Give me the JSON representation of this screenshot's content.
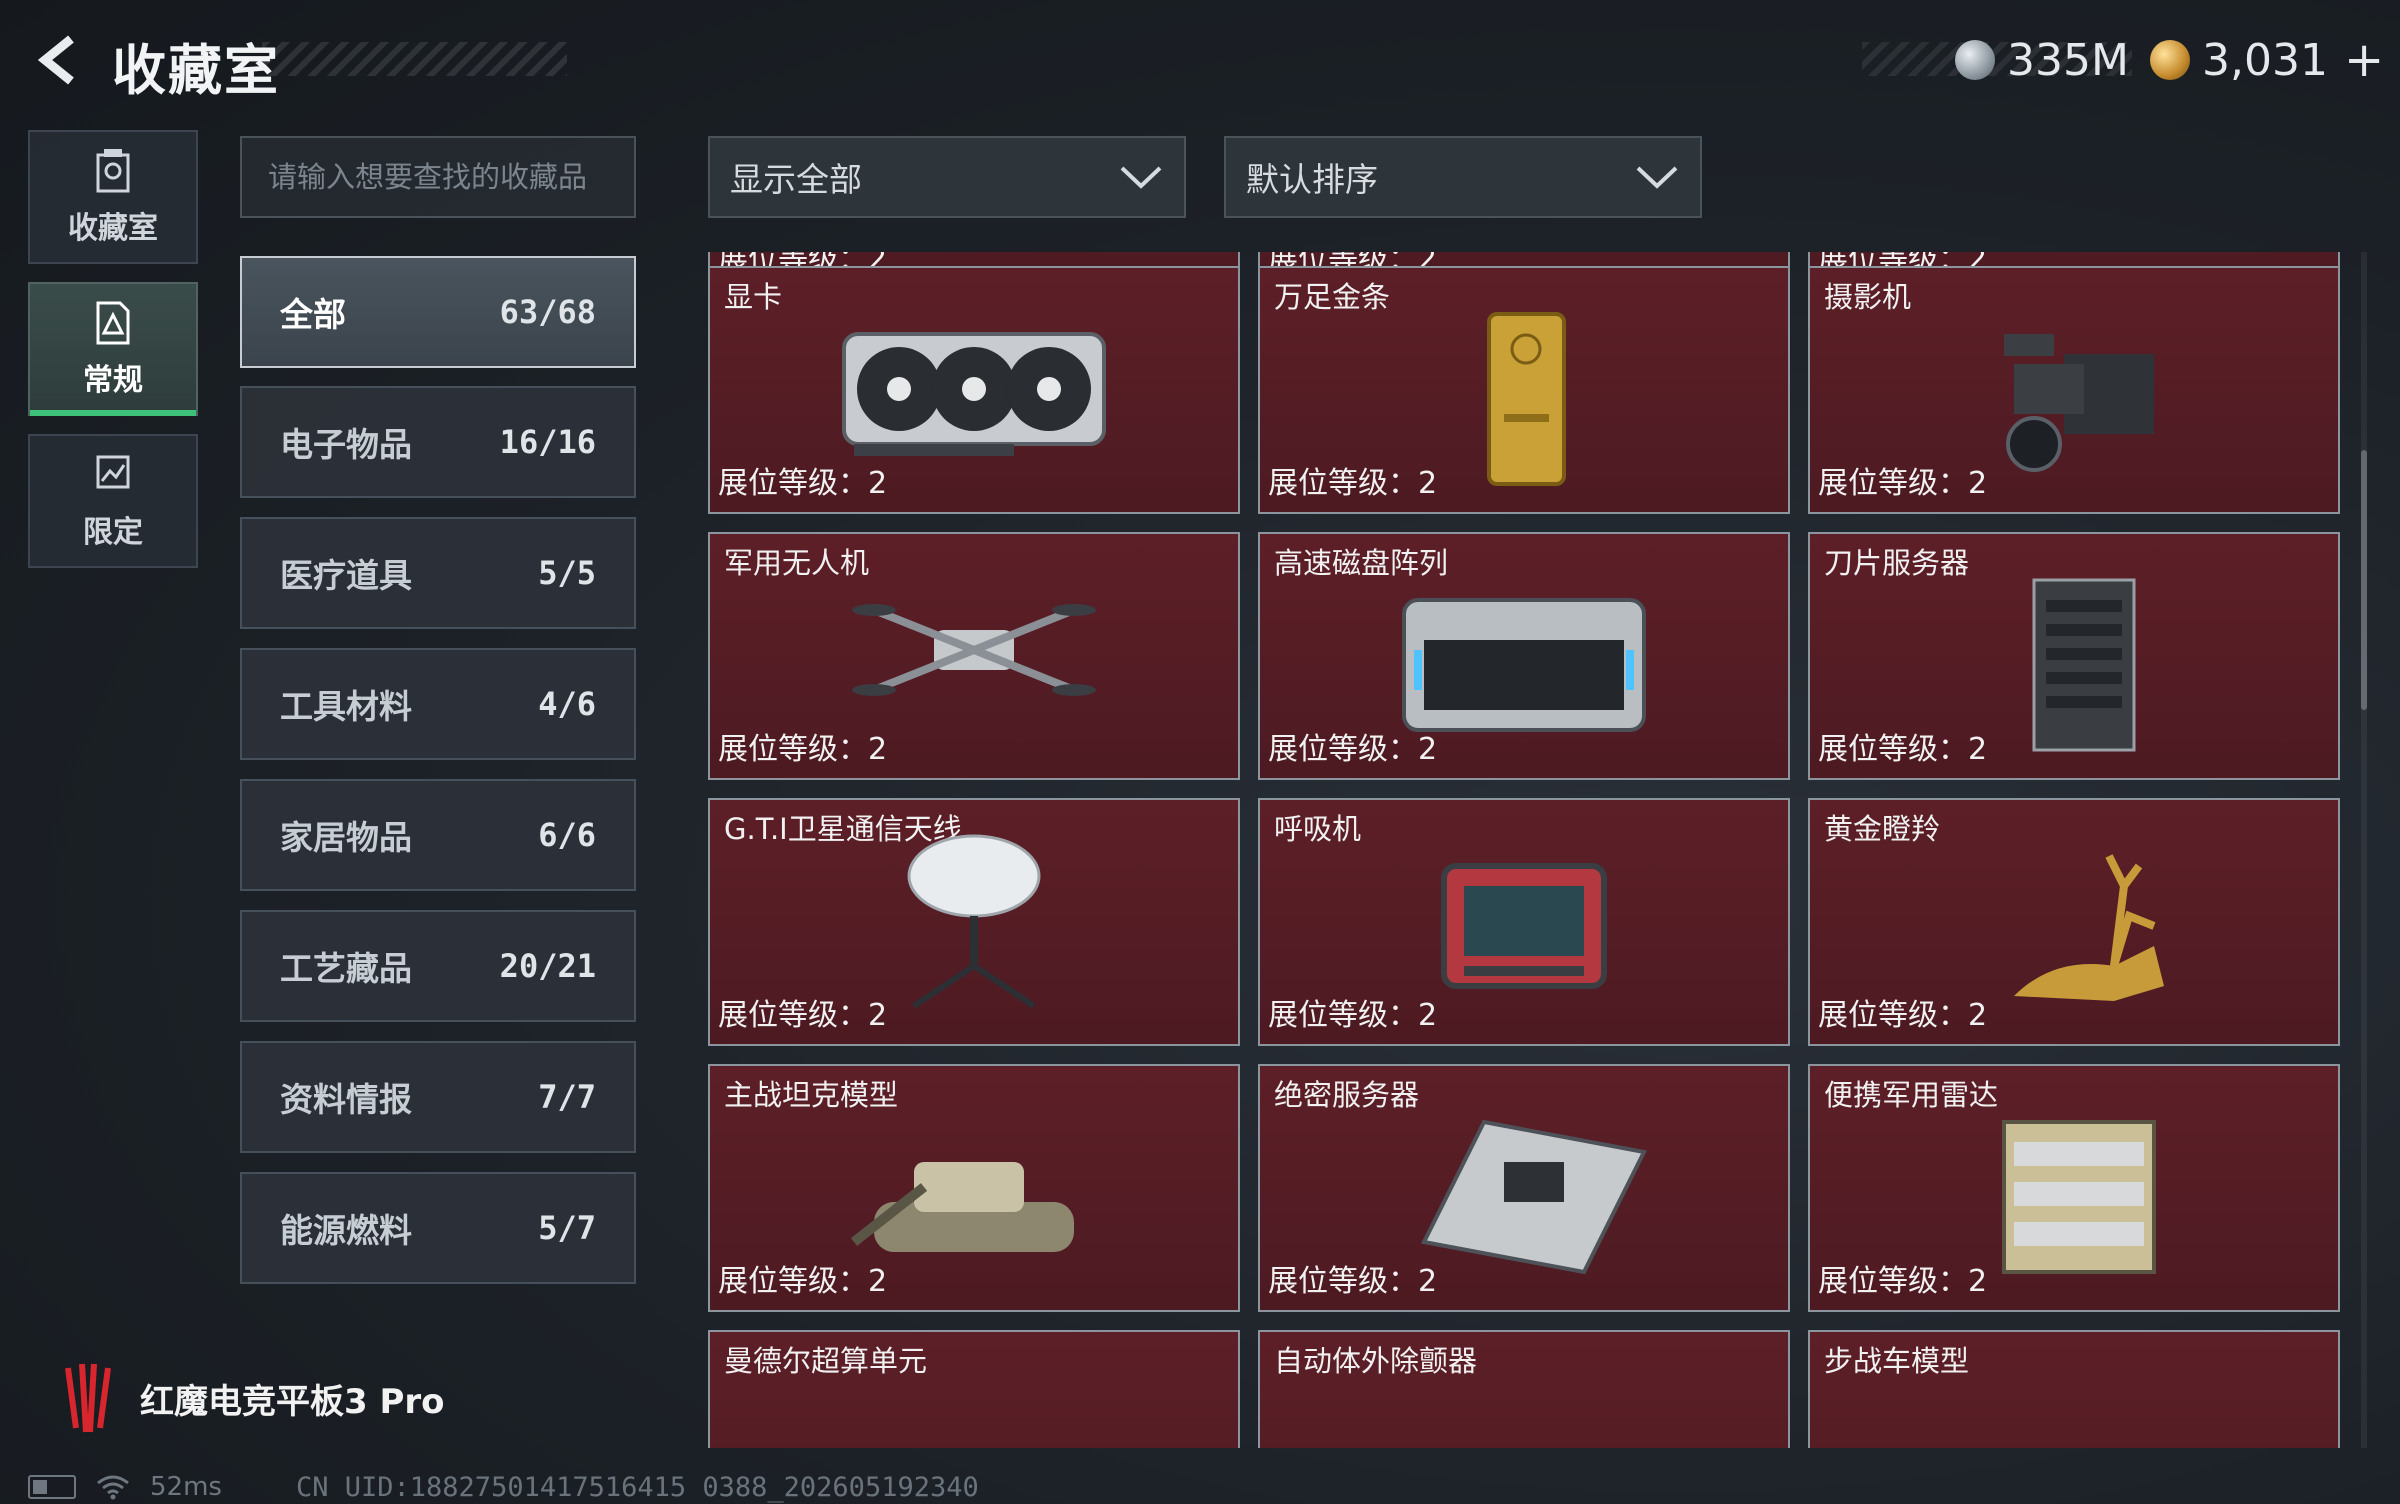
{
  "header": {
    "title": "收藏室",
    "currency1": "335M",
    "currency2": "3,031",
    "plus": "+"
  },
  "side_tabs": [
    {
      "label": "收藏室",
      "icon": "collection-room-icon"
    },
    {
      "label": "常规",
      "icon": "regular-icon"
    },
    {
      "label": "限定",
      "icon": "limited-icon"
    }
  ],
  "search": {
    "placeholder": "请输入想要查找的收藏品",
    "value": ""
  },
  "categories": [
    {
      "name": "全部",
      "count": "63/68"
    },
    {
      "name": "电子物品",
      "count": "16/16"
    },
    {
      "name": "医疗道具",
      "count": "5/5"
    },
    {
      "name": "工具材料",
      "count": "4/6"
    },
    {
      "name": "家居物品",
      "count": "6/6"
    },
    {
      "name": "工艺藏品",
      "count": "20/21"
    },
    {
      "name": "资料情报",
      "count": "7/7"
    },
    {
      "name": "能源燃料",
      "count": "5/7"
    }
  ],
  "filters": {
    "show": "显示全部",
    "sort": "默认排序"
  },
  "level_label": "展位等级：2",
  "items": [
    {
      "name": "",
      "icon": "partial-item-icon"
    },
    {
      "name": "",
      "icon": "partial-item-icon"
    },
    {
      "name": "",
      "icon": "partial-item-icon"
    },
    {
      "name": "显卡",
      "icon": "graphics-card-icon"
    },
    {
      "name": "万足金条",
      "icon": "gold-bar-icon"
    },
    {
      "name": "摄影机",
      "icon": "video-camera-icon"
    },
    {
      "name": "军用无人机",
      "icon": "drone-icon"
    },
    {
      "name": "高速磁盘阵列",
      "icon": "disk-array-icon"
    },
    {
      "name": "刀片服务器",
      "icon": "blade-server-icon"
    },
    {
      "name": "G.T.I卫星通信天线",
      "icon": "satellite-dish-icon"
    },
    {
      "name": "呼吸机",
      "icon": "ventilator-icon"
    },
    {
      "name": "黄金瞪羚",
      "icon": "golden-gazelle-icon"
    },
    {
      "name": "主战坦克模型",
      "icon": "tank-model-icon"
    },
    {
      "name": "绝密服务器",
      "icon": "secret-server-icon"
    },
    {
      "name": "便携军用雷达",
      "icon": "portable-radar-icon"
    },
    {
      "name": "曼德尔超算单元",
      "icon": "supercomputer-unit-icon"
    },
    {
      "name": "自动体外除颤器",
      "icon": "defibrillator-icon"
    },
    {
      "name": "步战车模型",
      "icon": "ifv-model-icon"
    }
  ],
  "brand": {
    "text": "红魔电竞平板3 Pro"
  },
  "status": {
    "ping": "52ms",
    "uid": "CN UID:18827501417516415 0388_202605192340"
  },
  "colors": {
    "card_bg": "#5d1f27",
    "active_tab_accent": "#3ec27a",
    "panel_bg": "#1c2127"
  }
}
